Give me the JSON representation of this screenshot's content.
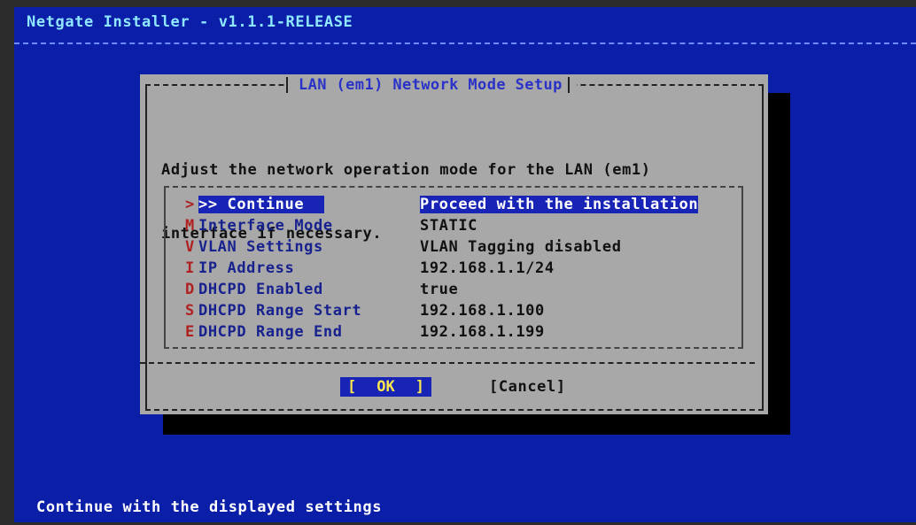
{
  "header": {
    "title": "Netgate Installer - v1.1.1-RELEASE"
  },
  "dialog": {
    "title": "LAN (em1) Network Mode Setup",
    "prompt_lines": [
      "Adjust the network operation mode for the LAN (em1)",
      "interface if necessary."
    ]
  },
  "menu": {
    "items": [
      {
        "key": ">",
        "label": ">> Continue",
        "value": "Proceed with the installation"
      },
      {
        "key": "M",
        "label": "Interface Mode",
        "value": "STATIC"
      },
      {
        "key": "V",
        "label": "VLAN Settings",
        "value": "VLAN Tagging disabled"
      },
      {
        "key": "I",
        "label": "IP Address",
        "value": "192.168.1.1/24"
      },
      {
        "key": "D",
        "label": "DHCPD Enabled",
        "value": "true"
      },
      {
        "key": "S",
        "label": "DHCPD Range Start",
        "value": "192.168.1.100"
      },
      {
        "key": "E",
        "label": "DHCPD Range End",
        "value": "192.168.1.199"
      }
    ]
  },
  "buttons": {
    "ok_left": "[",
    "ok_label": "OK",
    "ok_right": "]",
    "cancel_label": "[Cancel]"
  },
  "status_bar": {
    "text": "Continue with the displayed settings"
  },
  "colors": {
    "background": "#0b1ea8",
    "dialog": "#a8a8a8",
    "selection": "#1724b5",
    "hotkey": "#b02020",
    "title_text": "#8ee7ff"
  }
}
